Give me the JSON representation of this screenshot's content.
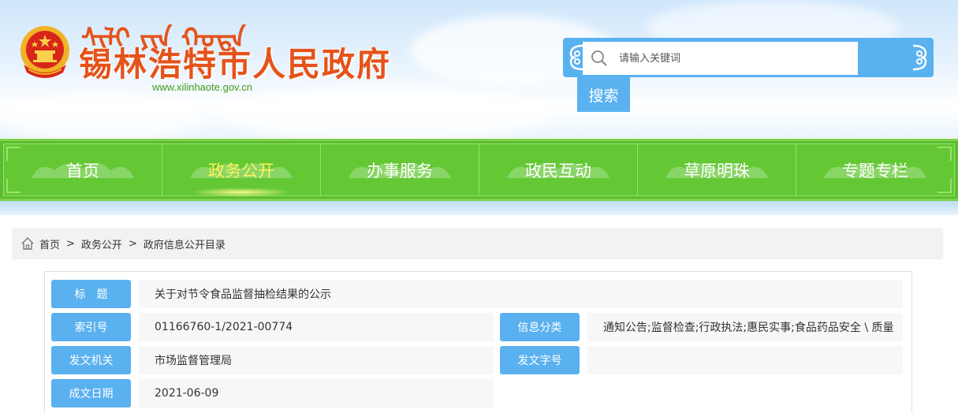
{
  "header": {
    "mongolian_script": "ᠰᠢᠯᠢ ᠶᠢᠨ ᠬᠣᠲᠠ",
    "site_title": "锡林浩特市人民政府",
    "site_url": "www.xilinhaote.gov.cn"
  },
  "search": {
    "placeholder": "请输入关键词",
    "value": "",
    "button_label": "搜索"
  },
  "nav": {
    "items": [
      {
        "label": "首页"
      },
      {
        "label": "政务公开"
      },
      {
        "label": "办事服务"
      },
      {
        "label": "政民互动"
      },
      {
        "label": "草原明珠"
      },
      {
        "label": "专题专栏"
      }
    ],
    "active_index": 1
  },
  "breadcrumb": {
    "items": [
      "首页",
      "政务公开",
      "政府信息公开目录"
    ],
    "separator": ">"
  },
  "info": {
    "title_label": "标　题",
    "title_value": "关于对节令食品监督抽检结果的公示",
    "index_label": "索引号",
    "index_value": "01166760-1/2021-00774",
    "category_label": "信息分类",
    "category_value": "通知公告;监督检查;行政执法;惠民实事;食品药品安全 \\ 质量",
    "issuer_label": "发文机关",
    "issuer_value": "市场监督管理局",
    "doc_number_label": "发文字号",
    "doc_number_value": "",
    "date_label": "成文日期",
    "date_value": "2021-06-09"
  },
  "colors": {
    "accent_blue": "#5ab1f0",
    "nav_green": "#63c834",
    "title_orange": "#e5531b",
    "active_nav_text": "#fff25a"
  },
  "icons": {
    "emblem": "national-emblem-icon",
    "search": "search-icon",
    "home": "home-icon"
  }
}
